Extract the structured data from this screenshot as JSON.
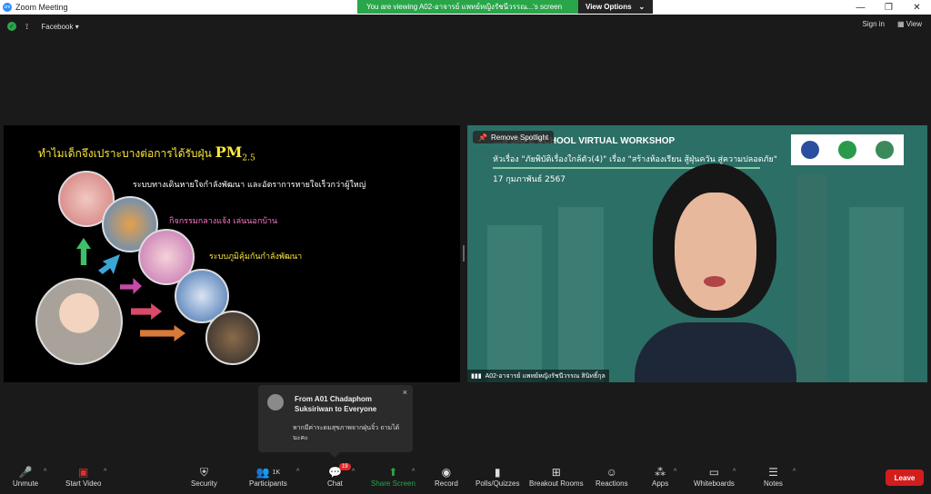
{
  "window": {
    "title": "Zoom Meeting"
  },
  "banner": {
    "viewing": "You are viewing A02-อาจารย์ แพทย์หญิงรัชนีวรรณ...'s screen",
    "options": "View Options",
    "options_caret": "⌄"
  },
  "window_controls": {
    "minimize": "—",
    "maximize": "❐",
    "close": "✕"
  },
  "topbar": {
    "facebook": "Facebook",
    "sign_in": "Sign in",
    "view": "View",
    "dropdown": "▾"
  },
  "slide": {
    "title_thai": "ทำไมเด็กจึงเปราะบางต่อการได้รับฝุ่น",
    "title_pm": "PM",
    "title_sub": "2.5",
    "line1": "ระบบทางเดินหายใจกำลังพัฒนา และอัตราการหายใจเร็วกว่าผู้ใหญ่",
    "line2": "กิจกรรมกลางแจ้ง เล่นนอกบ้าน",
    "line3": "ระบบภูมิคุ้มกันกำลังพัฒนา"
  },
  "workshop": {
    "title": "…S SAFE SCHOOL VIRTUAL WORKSHOP",
    "subtitle": "หัวเรื่อง \"ภัยพิบัติเรื่องใกล้ตัว(4)\" เรื่อง \"สร้างห้องเรียน สู้ฝุ่นควัน สู่ความปลอดภัย\"",
    "date": "17 กุมภาพันธ์ 2567",
    "spotlight": "Remove Spotlight",
    "participant_name": "A02-อาจารย์ แพทย์หญิงรัชนีวรรณ สินิทธิ์กุล"
  },
  "chat_popup": {
    "from": "From A01 Chadaphom Suksiriwan to Everyone",
    "message": "หากมีค่าระดมสุขภาพจากฝุ่นจิ๋ว ถามได้นะคะ",
    "close": "×"
  },
  "toolbar": {
    "caret": "^",
    "unmute": "Unmute",
    "start_video": "Start Video",
    "security": "Security",
    "participants": "Participants",
    "participants_count": "1K",
    "chat": "Chat",
    "chat_badge": "19",
    "share_screen": "Share Screen",
    "record": "Record",
    "polls": "Polls/Quizzes",
    "breakout": "Breakout Rooms",
    "reactions": "Reactions",
    "apps": "Apps",
    "whiteboards": "Whiteboards",
    "notes": "Notes",
    "leave": "Leave"
  },
  "colors": {
    "accent": "#29a64a",
    "leave": "#d21d1d",
    "slide_title": "#ffea3a"
  }
}
